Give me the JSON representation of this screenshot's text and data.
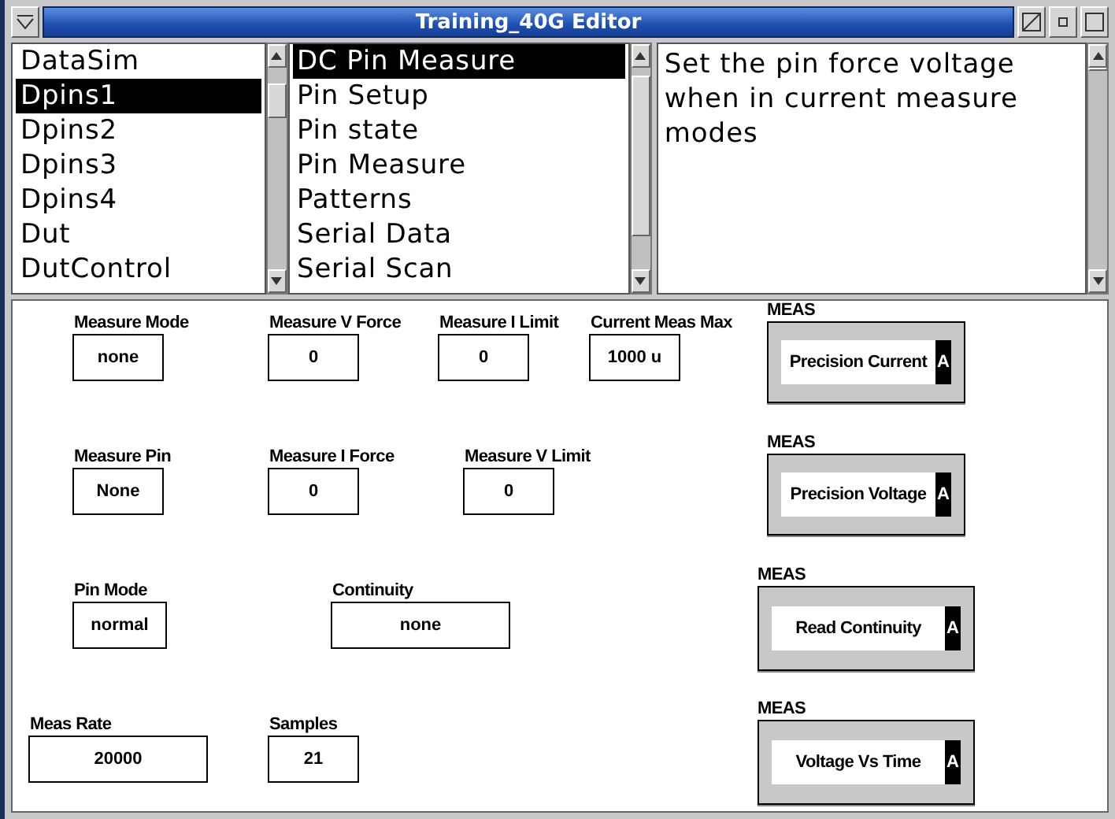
{
  "window": {
    "title": "Training_40G Editor"
  },
  "categories": [
    {
      "label": "DataSim",
      "selected": false
    },
    {
      "label": "Dpins1",
      "selected": true
    },
    {
      "label": "Dpins2",
      "selected": false
    },
    {
      "label": "Dpins3",
      "selected": false
    },
    {
      "label": "Dpins4",
      "selected": false
    },
    {
      "label": "Dut",
      "selected": false
    },
    {
      "label": "DutControl",
      "selected": false
    }
  ],
  "sections": [
    {
      "label": "DC Pin Measure",
      "selected": true
    },
    {
      "label": "Pin Setup",
      "selected": false
    },
    {
      "label": "Pin state",
      "selected": false
    },
    {
      "label": "Pin Measure",
      "selected": false
    },
    {
      "label": "Patterns",
      "selected": false
    },
    {
      "label": "Serial Data",
      "selected": false
    },
    {
      "label": "Serial Scan",
      "selected": false
    }
  ],
  "description": "Set the pin force voltage when in current measure modes",
  "fields": [
    {
      "label": "Measure Mode",
      "value": "none"
    },
    {
      "label": "Measure V Force",
      "value": "0"
    },
    {
      "label": "Measure I Limit",
      "value": "0"
    },
    {
      "label": "Current Meas Max",
      "value": "1000 u"
    },
    {
      "label": "Measure Pin",
      "value": "None"
    },
    {
      "label": "Measure I Force",
      "value": "0"
    },
    {
      "label": "Measure V Limit",
      "value": "0"
    },
    {
      "label": "Pin Mode",
      "value": "normal"
    },
    {
      "label": "Continuity",
      "value": "none"
    },
    {
      "label": "Meas Rate",
      "value": "20000"
    },
    {
      "label": "Samples",
      "value": "21"
    }
  ],
  "meas_buttons": [
    {
      "caption": "MEAS",
      "label": "Precision Current",
      "badge": "A"
    },
    {
      "caption": "MEAS",
      "label": "Precision Voltage",
      "badge": "A"
    },
    {
      "caption": "MEAS",
      "label": "Read Continuity",
      "badge": "A"
    },
    {
      "caption": "MEAS",
      "label": "Voltage Vs Time",
      "badge": "A"
    }
  ]
}
